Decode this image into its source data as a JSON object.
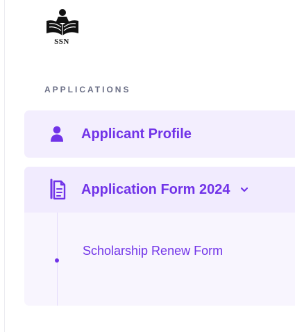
{
  "logo": {
    "text": "SSN"
  },
  "sidebar": {
    "section_title": "APPLICATIONS",
    "items": [
      {
        "label": "Applicant Profile",
        "icon": "user-icon"
      },
      {
        "label": "Application Form 2024",
        "icon": "document-icon",
        "expanded": true,
        "submenu": [
          {
            "label": "Scholarship Renew Form"
          }
        ]
      }
    ]
  },
  "colors": {
    "accent": "#7133e8",
    "active_background": "#f3eefe",
    "submenu_background": "#f8f5fe",
    "section_text": "#6b6f86"
  }
}
